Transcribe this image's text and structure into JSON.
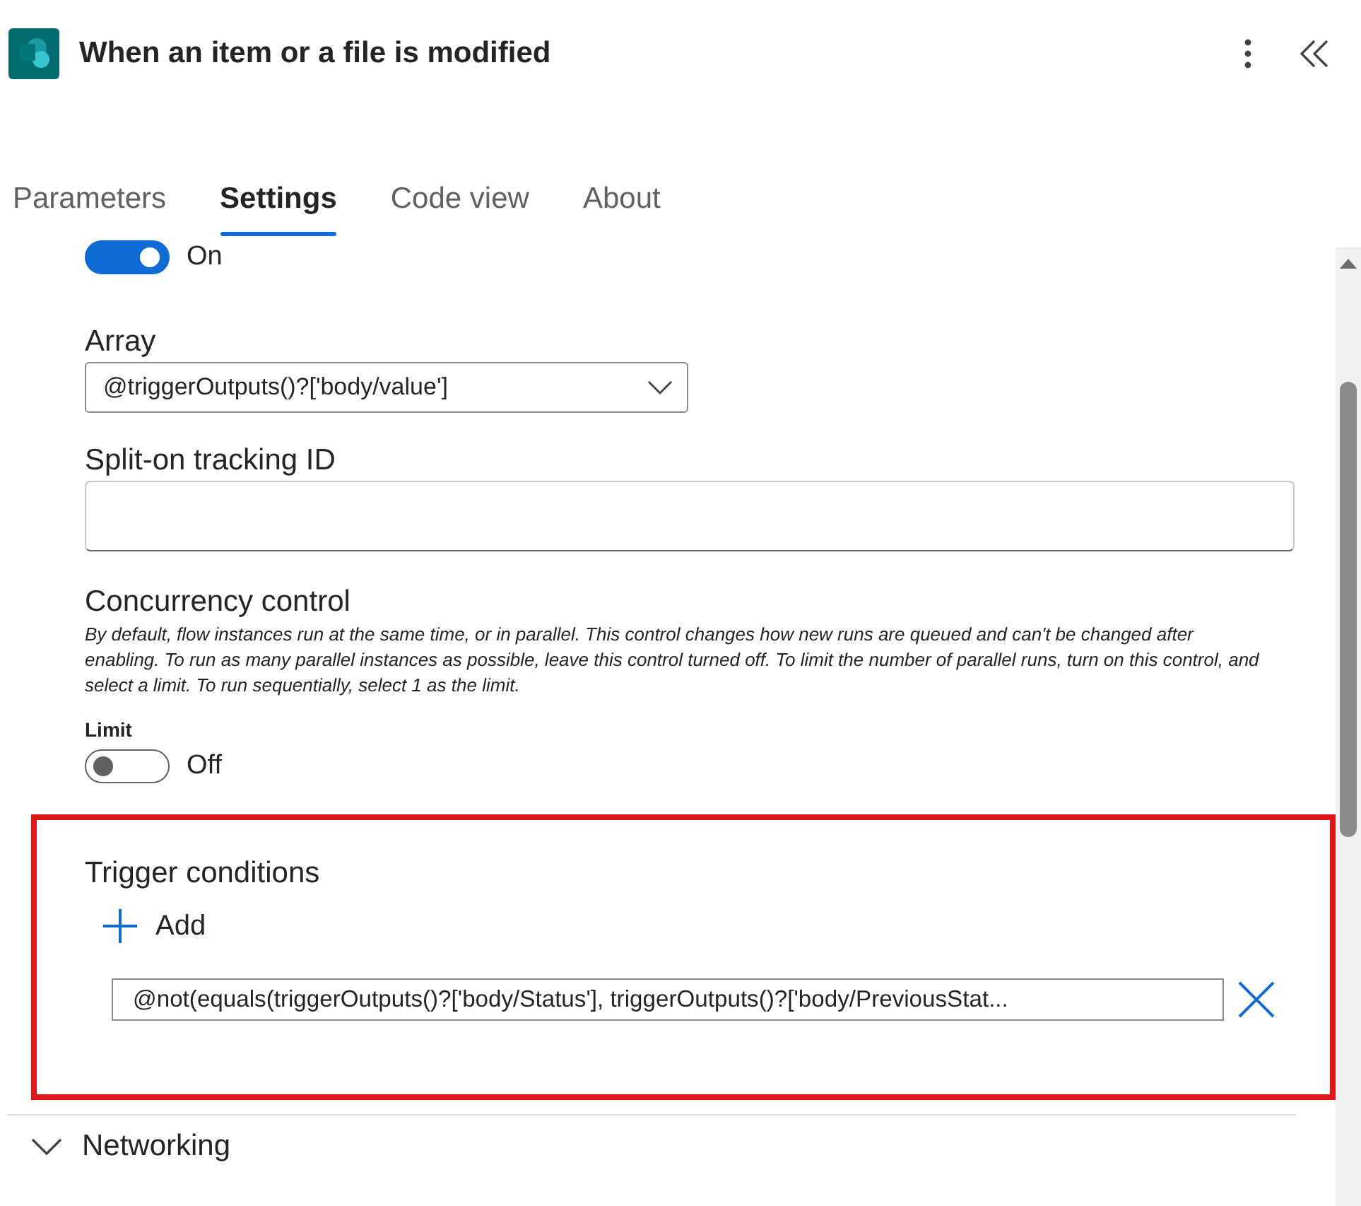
{
  "header": {
    "title": "When an item or a file is modified"
  },
  "tabs": [
    {
      "label": "Parameters",
      "selected": false
    },
    {
      "label": "Settings",
      "selected": true
    },
    {
      "label": "Code view",
      "selected": false
    },
    {
      "label": "About",
      "selected": false
    }
  ],
  "split_on": {
    "on": true,
    "state_label": "On"
  },
  "array": {
    "label": "Array",
    "value": "@triggerOutputs()?['body/value']"
  },
  "tracking_id": {
    "label": "Split-on tracking ID"
  },
  "concurrency": {
    "title": "Concurrency control",
    "description": "By default, flow instances run at the same time, or in parallel. This control changes how new runs are queued and can't be changed after enabling. To run as many parallel instances as possible, leave this control turned off. To limit the number of parallel runs, turn on this control, and select a limit. To run sequentially, select 1 as the limit.",
    "limit_label": "Limit",
    "on": false,
    "state_label": "Off"
  },
  "trigger_conditions": {
    "title": "Trigger conditions",
    "add_label": "Add",
    "conditions": [
      "@not(equals(triggerOutputs()?['body/Status'], triggerOutputs()?['body/PreviousStat..."
    ]
  },
  "sections": [
    {
      "label": "Networking"
    }
  ]
}
